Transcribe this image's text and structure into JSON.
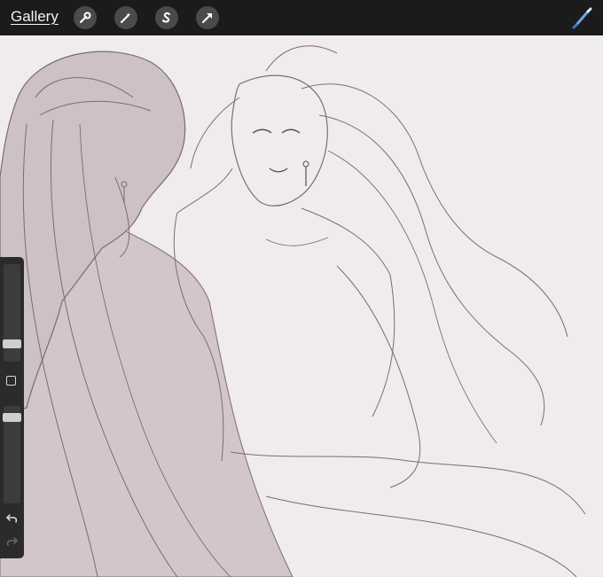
{
  "topbar": {
    "gallery_label": "Gallery",
    "tools": [
      "wrench-icon",
      "magic-wand-icon",
      "selection-s-icon",
      "transform-arrow-icon"
    ],
    "active_tool": "brush-icon"
  },
  "colors": {
    "topbar_bg": "#1b1b1b",
    "canvas_bg": "#f1ecec",
    "figure_fill": "#d2c6cc",
    "line": "#7a6c72",
    "brush_accent": "#6aa7e8"
  },
  "sidebar": {
    "brush_size_level": 0.8,
    "opacity_level": 0.15,
    "icons": [
      "modify-square-icon",
      "undo-icon",
      "redo-icon"
    ]
  }
}
